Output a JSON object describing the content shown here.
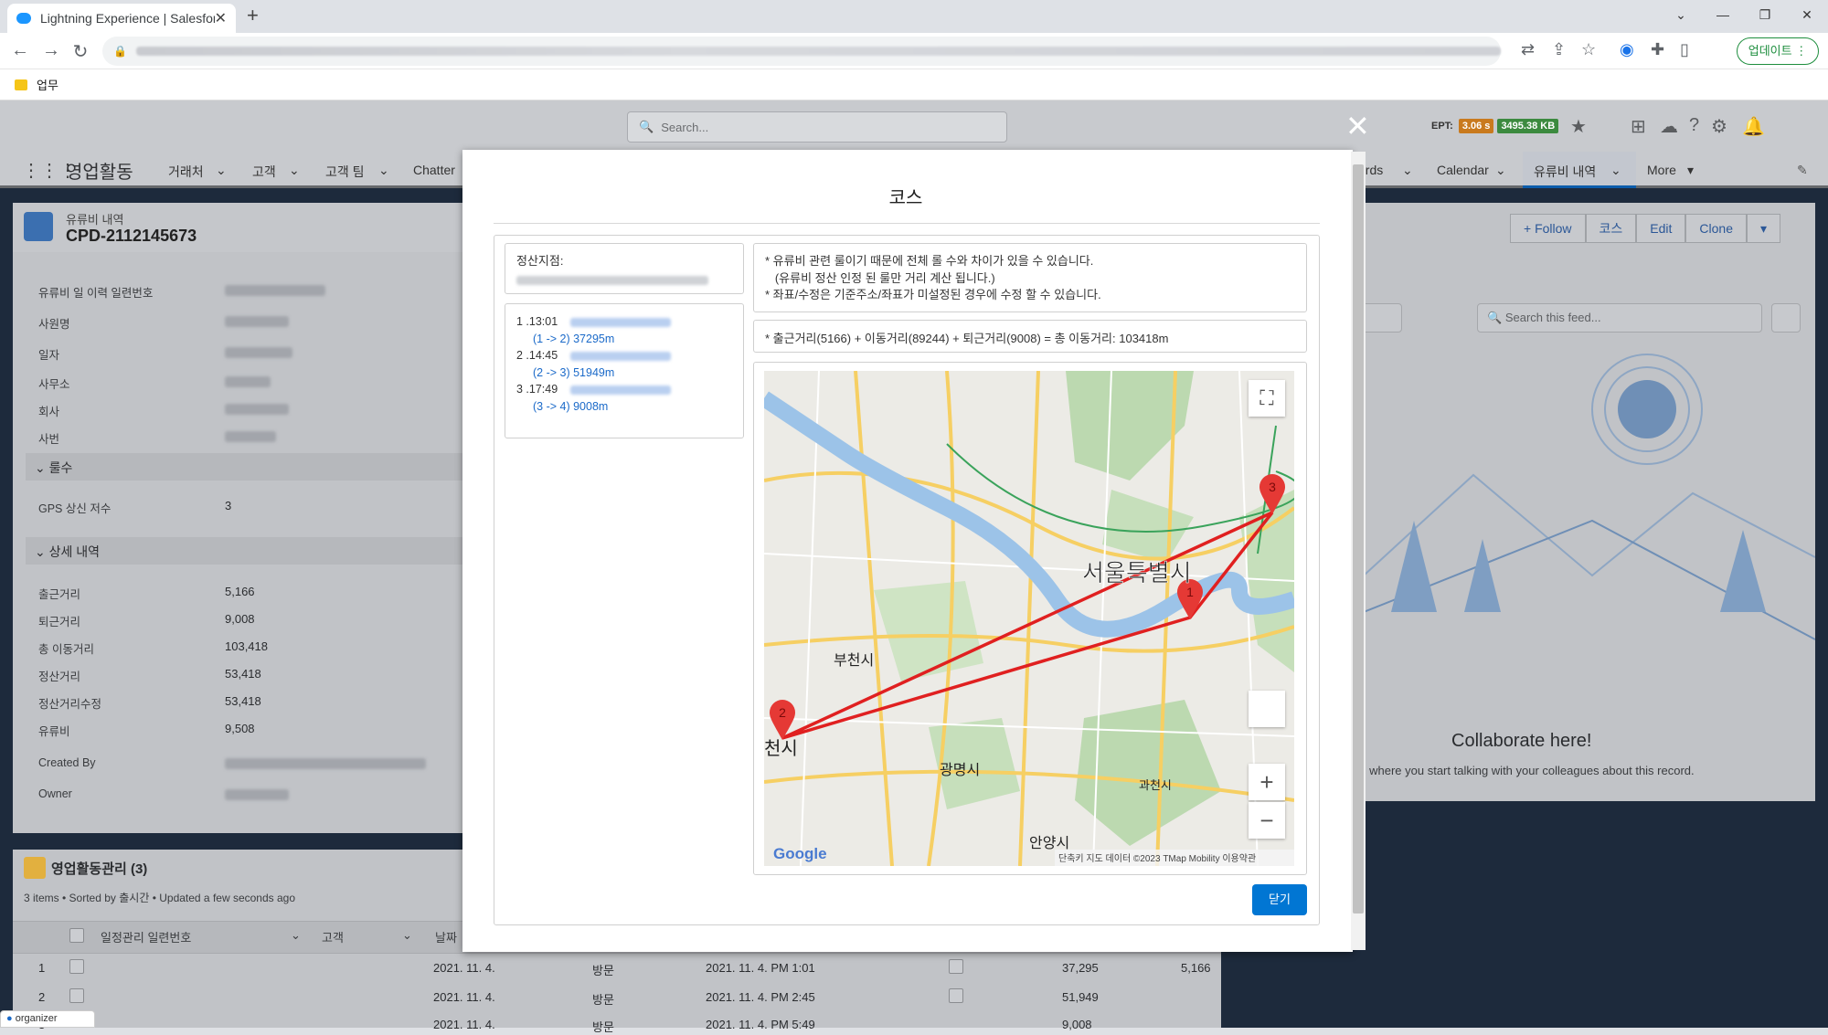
{
  "browser": {
    "tab_title": "Lightning Experience | Salesforce",
    "new_tab": "+",
    "win_min": "—",
    "win_max": "❐",
    "win_close": "✕",
    "win_down": "⌄",
    "update_label": "업데이트",
    "bookmark": "업무"
  },
  "header": {
    "search_placeholder": "Search...",
    "ept_label": "EPT:",
    "ept_time": "3.06 s",
    "ept_size": "3495.38 KB"
  },
  "nav": {
    "app_name": "영업활동",
    "items": [
      "거래처",
      "고객",
      "고객 팀",
      "Chatter",
      "ards",
      "Calendar",
      "유류비 내역",
      "More"
    ]
  },
  "record": {
    "object": "유류비 내역",
    "name": "CPD-2112145673",
    "fields": [
      {
        "label": "유류비 일 이력 일련번호"
      },
      {
        "label": "사원명"
      },
      {
        "label": "일자"
      },
      {
        "label": "사무소"
      },
      {
        "label": "회사"
      },
      {
        "label": "사번"
      }
    ],
    "section1": "⌄ 룰수",
    "gps_label": "GPS 상신 저수",
    "gps_value": "3",
    "section2": "⌄ 상세 내역",
    "details": [
      {
        "label": "출근거리",
        "value": "5,166"
      },
      {
        "label": "퇴근거리",
        "value": "9,008"
      },
      {
        "label": "총 이동거리",
        "value": "103,418"
      },
      {
        "label": "정산거리",
        "value": "53,418"
      },
      {
        "label": "정산거리수정",
        "value": "53,418"
      },
      {
        "label": "유류비",
        "value": "9,508"
      }
    ],
    "created_by": "Created By",
    "owner": "Owner"
  },
  "actions": [
    "+ Follow",
    "코스",
    "Edit",
    "Clone",
    "▾"
  ],
  "feed": {
    "search_placeholder": "Search this feed...",
    "collab_title": "Collaborate here!",
    "collab_sub": "s where you start talking with your colleagues about this record."
  },
  "related": {
    "title": "영업활동관리 (3)",
    "subtitle": "3 items • Sorted by 출시간 • Updated a few seconds ago",
    "headers": [
      "일정관리 일련번호",
      "고객",
      "날짜"
    ],
    "rows": [
      {
        "num": "1",
        "date": "2021. 11. 4.",
        "type": "방문",
        "datetime": "2021. 11. 4. PM 1:01",
        "dist": "37,295",
        "out": "5,166"
      },
      {
        "num": "2",
        "date": "2021. 11. 4.",
        "type": "방문",
        "datetime": "2021. 11. 4. PM 2:45",
        "dist": "51,949",
        "out": ""
      },
      {
        "num": "3",
        "date": "2021. 11. 4.",
        "type": "방문",
        "datetime": "2021. 11. 4. PM 5:49",
        "dist": "9,008",
        "out": ""
      }
    ]
  },
  "organizer": "organizer",
  "modal": {
    "title": "코스",
    "close_x": "✕",
    "settle_label": "정산지점:",
    "routes": [
      {
        "time": "1 .13:01",
        "seg": "(1 -> 2)  37295m"
      },
      {
        "time": "2 .14:45",
        "seg": "(2 -> 3)  51949m"
      },
      {
        "time": "3 .17:49",
        "seg": "(3 -> 4)  9008m"
      }
    ],
    "notice": "* 유류비 관련 룰이기 때문에 전체 롤 수와 차이가 있을 수 있습니다.\n   (유류비 정산 인정 된 룰만 거리 계산 됩니다.)\n* 좌표/수정은 기준주소/좌표가 미설정된 경우에 수정 할 수 있습니다.",
    "distance": "* 출근거리(5166) + 이동거리(89244) + 퇴근거리(9008) = 총 이동거리: 103418m",
    "close_button": "닫기",
    "map": {
      "city_main": "서울특별시",
      "bucheon": "부천시",
      "gwangmyeong": "광명시",
      "anyang": "안양시",
      "gwacheon": "과천시",
      "left_city": "천시",
      "google": "Google",
      "attribution": "단축키   지도 데이터 ©2023 TMap Mobility   이용약관",
      "fullscreen": "⛶",
      "zoom_in": "+",
      "zoom_out": "−",
      "markers": [
        "1",
        "2",
        "3"
      ]
    }
  }
}
